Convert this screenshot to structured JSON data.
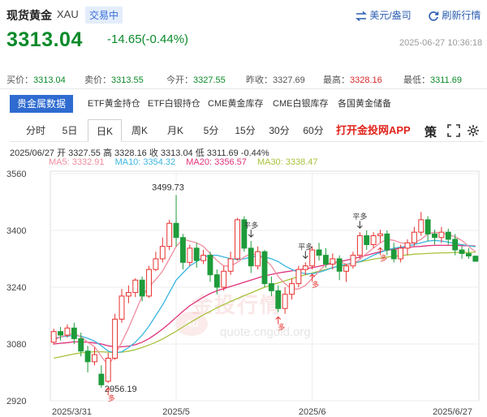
{
  "header": {
    "title": "现货黄金",
    "symbol": "XAU",
    "badge": "交易中",
    "unit_link": "美元/盎司",
    "refresh_link": "刷新行情"
  },
  "quote": {
    "price": "3313.04",
    "change": "-14.65(-0.44%)",
    "datetime": "2025-06-27 10:36:18"
  },
  "stats": [
    {
      "label": "买价：",
      "value": "3313.04",
      "color": "green"
    },
    {
      "label": "卖价：",
      "value": "3313.55",
      "color": "green"
    },
    {
      "label": "今开：",
      "value": "3327.55",
      "color": "green"
    },
    {
      "label": "昨收：",
      "value": "3327.69",
      "color": "gray"
    },
    {
      "label": "最高：",
      "value": "3328.16",
      "color": "red"
    },
    {
      "label": "最低：",
      "value": "3311.69",
      "color": "green"
    }
  ],
  "categories": [
    "贵金属数据",
    "ETF黄金持仓",
    "ETF白银持仓",
    "CME黄金库存",
    "CME白银库存",
    "各国黄金储备"
  ],
  "periods": [
    "分时",
    "5日",
    "日K",
    "周K",
    "月K",
    "5分",
    "15分",
    "30分",
    "60分"
  ],
  "active_period": "日K",
  "app_link": "打开金投网APP",
  "controls": {
    "strategy": "策"
  },
  "ohlc_line": "2025/06/27  开 3327.55  高 3328.16  收 3313.04  低 3311.69  -0.44%",
  "ma": [
    {
      "label": "MA5: 3332.91",
      "color": "#f08c9e"
    },
    {
      "label": "MA10: 3354.32",
      "color": "#3bb6e0"
    },
    {
      "label": "MA20: 3356.57",
      "color": "#e0327a"
    },
    {
      "label": "MA30: 3338.47",
      "color": "#a8c23c"
    }
  ],
  "watermark": {
    "cn": "金投行情",
    "en": "quote.cngold.org",
    "logo": "Au"
  },
  "chart_data": {
    "type": "candlestick",
    "y_ticks": [
      3560,
      3400,
      3240,
      3080,
      2920
    ],
    "ylim": [
      2900,
      3570
    ],
    "x_ticks": [
      "2025/3/31",
      "2025/5",
      "2025/6",
      "2025/6/27"
    ],
    "annotations": {
      "max": "3499.73",
      "min": "2956.19",
      "flat_label": "平多",
      "long_label": "多"
    },
    "candles": [
      [
        3085,
        3115,
        3123,
        3078
      ],
      [
        3115,
        3105,
        3128,
        3090
      ],
      [
        3105,
        3125,
        3135,
        3098
      ],
      [
        3125,
        3095,
        3140,
        3080
      ],
      [
        3095,
        3060,
        3112,
        3045
      ],
      [
        3060,
        3030,
        3075,
        3000
      ],
      [
        3030,
        3050,
        3070,
        3020
      ],
      [
        2995,
        2965,
        3020,
        2956.19
      ],
      [
        2975,
        3040,
        3055,
        2970
      ],
      [
        3040,
        3150,
        3165,
        3035
      ],
      [
        3150,
        3215,
        3235,
        3140
      ],
      [
        3215,
        3225,
        3245,
        3195
      ],
      [
        3225,
        3260,
        3265,
        3212
      ],
      [
        3260,
        3215,
        3270,
        3200
      ],
      [
        3215,
        3290,
        3300,
        3210
      ],
      [
        3290,
        3320,
        3340,
        3285
      ],
      [
        3320,
        3355,
        3380,
        3310
      ],
      [
        3355,
        3420,
        3430,
        3345
      ],
      [
        3420,
        3380,
        3499.73,
        3355
      ],
      [
        3380,
        3310,
        3390,
        3290
      ],
      [
        3310,
        3350,
        3360,
        3300
      ],
      [
        3350,
        3315,
        3365,
        3295
      ],
      [
        3315,
        3330,
        3345,
        3305
      ],
      [
        3330,
        3275,
        3340,
        3255
      ],
      [
        3275,
        3240,
        3290,
        3220
      ],
      [
        3240,
        3285,
        3300,
        3230
      ],
      [
        3285,
        3320,
        3340,
        3275
      ],
      [
        3320,
        3430,
        3435,
        3315
      ],
      [
        3430,
        3350,
        3440,
        3340
      ],
      [
        3350,
        3300,
        3370,
        3280
      ],
      [
        3300,
        3340,
        3355,
        3290
      ],
      [
        3340,
        3250,
        3345,
        3240
      ],
      [
        3250,
        3230,
        3270,
        3215
      ],
      [
        3230,
        3180,
        3245,
        3170
      ],
      [
        3180,
        3220,
        3240,
        3165
      ],
      [
        3220,
        3250,
        3265,
        3205
      ],
      [
        3250,
        3290,
        3300,
        3240
      ],
      [
        3290,
        3300,
        3310,
        3275
      ],
      [
        3300,
        3345,
        3355,
        3290
      ],
      [
        3345,
        3330,
        3365,
        3315
      ],
      [
        3330,
        3305,
        3350,
        3295
      ],
      [
        3305,
        3320,
        3335,
        3290
      ],
      [
        3320,
        3285,
        3330,
        3260
      ],
      [
        3285,
        3300,
        3305,
        3255
      ],
      [
        3300,
        3330,
        3340,
        3292
      ],
      [
        3330,
        3385,
        3395,
        3320
      ],
      [
        3385,
        3360,
        3400,
        3345
      ],
      [
        3360,
        3385,
        3395,
        3350
      ],
      [
        3385,
        3390,
        3402,
        3365
      ],
      [
        3390,
        3345,
        3400,
        3330
      ],
      [
        3345,
        3320,
        3365,
        3310
      ],
      [
        3320,
        3350,
        3360,
        3310
      ],
      [
        3350,
        3365,
        3375,
        3330
      ],
      [
        3365,
        3395,
        3410,
        3355
      ],
      [
        3395,
        3430,
        3452,
        3385
      ],
      [
        3430,
        3390,
        3440,
        3370
      ],
      [
        3390,
        3380,
        3402,
        3360
      ],
      [
        3380,
        3395,
        3410,
        3365
      ],
      [
        3395,
        3375,
        3405,
        3360
      ],
      [
        3375,
        3345,
        3390,
        3330
      ],
      [
        3345,
        3335,
        3355,
        3320
      ],
      [
        3335,
        3328,
        3350,
        3320
      ],
      [
        3327.55,
        3313.04,
        3328.16,
        3311.69
      ]
    ],
    "ma5": [
      3090,
      3100,
      3105,
      3110,
      3100,
      3085,
      3072,
      3045,
      3020,
      3048,
      3085,
      3125,
      3170,
      3215,
      3240,
      3262,
      3285,
      3320,
      3355,
      3375,
      3370,
      3365,
      3355,
      3335,
      3315,
      3300,
      3300,
      3310,
      3325,
      3335,
      3330,
      3320,
      3300,
      3270,
      3250,
      3235,
      3235,
      3245,
      3265,
      3285,
      3305,
      3310,
      3312,
      3305,
      3305,
      3318,
      3335,
      3350,
      3365,
      3375,
      3372,
      3365,
      3362,
      3365,
      3375,
      3390,
      3395,
      3392,
      3388,
      3382,
      3372,
      3355,
      3340
    ],
    "ma10": [
      3095,
      3100,
      3102,
      3104,
      3102,
      3096,
      3088,
      3075,
      3060,
      3055,
      3058,
      3070,
      3085,
      3105,
      3130,
      3160,
      3190,
      3225,
      3260,
      3280,
      3300,
      3312,
      3325,
      3330,
      3330,
      3325,
      3320,
      3318,
      3320,
      3325,
      3328,
      3325,
      3320,
      3312,
      3300,
      3290,
      3282,
      3278,
      3278,
      3282,
      3288,
      3295,
      3300,
      3305,
      3308,
      3312,
      3320,
      3330,
      3338,
      3345,
      3350,
      3353,
      3356,
      3360,
      3365,
      3370,
      3372,
      3370,
      3367,
      3363,
      3360,
      3357,
      3354
    ],
    "ma20": [
      3080,
      3082,
      3084,
      3086,
      3086,
      3085,
      3083,
      3080,
      3075,
      3072,
      3072,
      3074,
      3078,
      3085,
      3095,
      3108,
      3122,
      3138,
      3155,
      3172,
      3188,
      3200,
      3212,
      3222,
      3230,
      3236,
      3242,
      3248,
      3254,
      3260,
      3266,
      3272,
      3276,
      3280,
      3283,
      3286,
      3289,
      3292,
      3295,
      3299,
      3303,
      3307,
      3312,
      3316,
      3320,
      3325,
      3330,
      3335,
      3340,
      3344,
      3347,
      3350,
      3352,
      3354,
      3355,
      3357,
      3358,
      3358,
      3358,
      3358,
      3357,
      3357,
      3356
    ],
    "ma30": [
      3040,
      3044,
      3048,
      3052,
      3055,
      3057,
      3058,
      3058,
      3057,
      3056,
      3057,
      3060,
      3064,
      3070,
      3077,
      3085,
      3094,
      3105,
      3116,
      3128,
      3140,
      3151,
      3162,
      3172,
      3182,
      3191,
      3200,
      3208,
      3216,
      3224,
      3232,
      3240,
      3246,
      3252,
      3258,
      3264,
      3270,
      3275,
      3280,
      3285,
      3290,
      3295,
      3299,
      3303,
      3307,
      3311,
      3315,
      3319,
      3322,
      3325,
      3327,
      3329,
      3331,
      3333,
      3334,
      3335,
      3336,
      3337,
      3337,
      3338,
      3338,
      3338,
      3338.47
    ]
  }
}
